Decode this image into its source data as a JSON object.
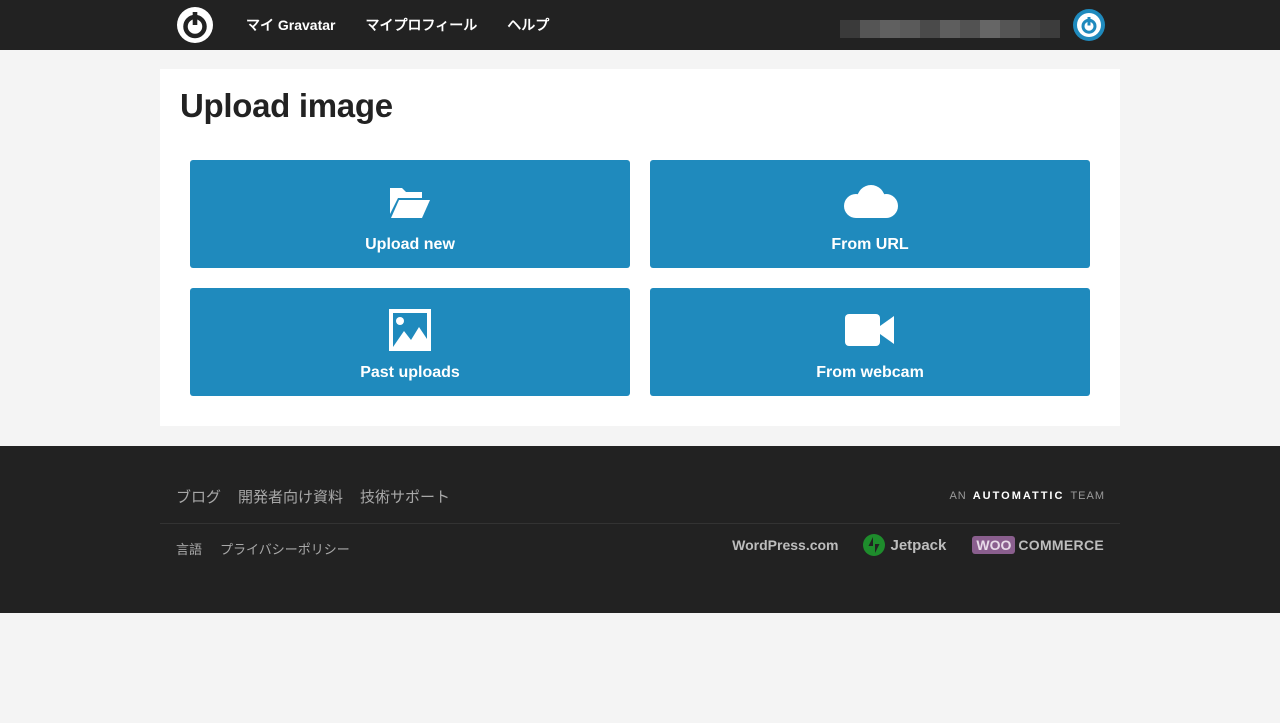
{
  "header": {
    "nav": [
      "マイ Gravatar",
      "マイプロフィール",
      "ヘルプ"
    ]
  },
  "main": {
    "title": "Upload image",
    "tiles": [
      {
        "label": "Upload new",
        "icon": "folder-open-icon"
      },
      {
        "label": "From URL",
        "icon": "cloud-icon"
      },
      {
        "label": "Past uploads",
        "icon": "image-icon"
      },
      {
        "label": "From webcam",
        "icon": "video-camera-icon"
      }
    ]
  },
  "footer": {
    "links_primary": [
      "ブログ",
      "開発者向け資料",
      "技術サポート"
    ],
    "links_secondary": [
      "言語",
      "プライバシーポリシー"
    ],
    "automattic": {
      "prefix": "AN",
      "brand": "AUTOMATTIC",
      "suffix": "TEAM"
    },
    "brands": {
      "wordpress": "WordPress.com",
      "jetpack": "Jetpack",
      "woo": "WOO",
      "commerce": "COMMERCE"
    }
  },
  "colors": {
    "accent": "#1f8abd",
    "dark_bg": "#222222",
    "page_bg": "#f4f4f4"
  }
}
